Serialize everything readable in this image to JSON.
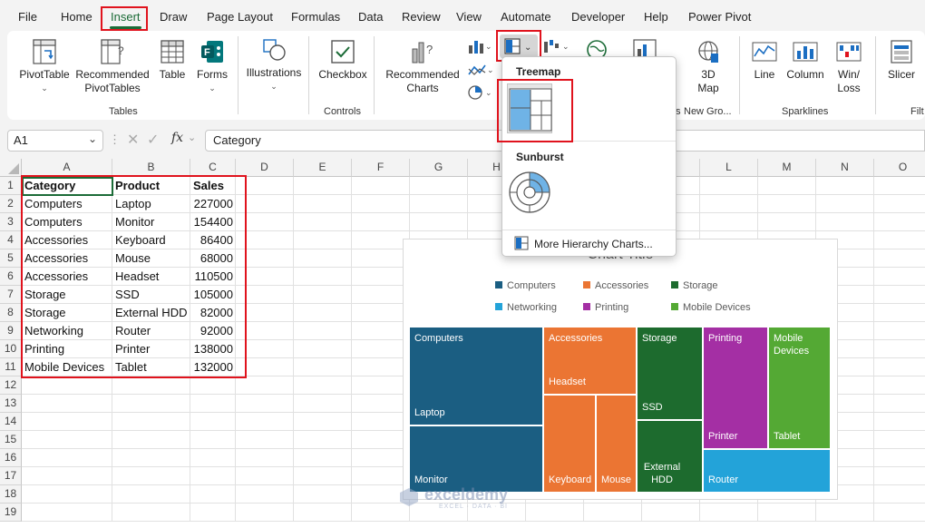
{
  "menu": {
    "tabs": [
      "File",
      "Home",
      "Insert",
      "Draw",
      "Page Layout",
      "Formulas",
      "Data",
      "Review",
      "View",
      "Automate",
      "Developer",
      "Help",
      "Power Pivot"
    ],
    "active": "Insert"
  },
  "ribbon": {
    "pivottable": "PivotTable",
    "recommended_pivottables": "Recommended PivotTables",
    "table": "Table",
    "forms": "Forms",
    "illustrations": "Illustrations",
    "checkbox": "Checkbox",
    "recommended_charts": "Recommended Charts",
    "map": "3D Map",
    "line": "Line",
    "column": "Column",
    "winloss": "Win/ Loss",
    "slicer": "Slicer",
    "groups": {
      "tables": "Tables",
      "controls": "Controls",
      "new_group": "New Gro...",
      "sparklines": "Sparklines",
      "filters": "Filt"
    }
  },
  "formula_bar": {
    "name_box": "A1",
    "fx": "fx",
    "formula": "Category"
  },
  "columns": [
    "A",
    "B",
    "C",
    "D",
    "E",
    "F",
    "G",
    "H",
    "I",
    "J",
    "K",
    "L",
    "M",
    "N",
    "O"
  ],
  "rows": [
    "1",
    "2",
    "3",
    "4",
    "5",
    "6",
    "7",
    "8",
    "9",
    "10",
    "11",
    "12",
    "13",
    "14",
    "15",
    "16",
    "17",
    "18",
    "19"
  ],
  "table": {
    "headers": [
      "Category",
      "Product",
      "Sales"
    ],
    "rows": [
      [
        "Computers",
        "Laptop",
        "227000"
      ],
      [
        "Computers",
        "Monitor",
        "154400"
      ],
      [
        "Accessories",
        "Keyboard",
        "86400"
      ],
      [
        "Accessories",
        "Mouse",
        "68000"
      ],
      [
        "Accessories",
        "Headset",
        "110500"
      ],
      [
        "Storage",
        "SSD",
        "105000"
      ],
      [
        "Storage",
        "External HDD",
        "82000"
      ],
      [
        "Networking",
        "Router",
        "92000"
      ],
      [
        "Printing",
        "Printer",
        "138000"
      ],
      [
        "Mobile Devices",
        "Tablet",
        "132000"
      ]
    ]
  },
  "dropdown": {
    "treemap_title": "Treemap",
    "sunburst_title": "Sunburst",
    "more_link": "More Hierarchy Charts..."
  },
  "chart": {
    "title": "Chart Title",
    "legend": [
      {
        "name": "Computers",
        "color": "#1b5e82"
      },
      {
        "name": "Accessories",
        "color": "#eb7533"
      },
      {
        "name": "Storage",
        "color": "#1d6b2e"
      },
      {
        "name": "Networking",
        "color": "#23a3d9"
      },
      {
        "name": "Printing",
        "color": "#a42fa4"
      },
      {
        "name": "Mobile Devices",
        "color": "#54a934"
      }
    ],
    "tiles": {
      "computers": {
        "parent": "Computers",
        "leaf": "Laptop"
      },
      "monitor": {
        "leaf": "Monitor"
      },
      "accessories": {
        "parent": "Accessories",
        "leaf": "Headset"
      },
      "keyboard": {
        "leaf": "Keyboard"
      },
      "mouse": {
        "leaf": "Mouse"
      },
      "storage": {
        "parent": "Storage",
        "leaf": "SSD"
      },
      "hdd": {
        "leaf": "External HDD"
      },
      "printing": {
        "parent": "Printing",
        "leaf": "Printer"
      },
      "mobile": {
        "parent": "Mobile Devices",
        "leaf": "Tablet"
      },
      "router": {
        "leaf": "Router"
      }
    }
  },
  "chart_data": {
    "type": "treemap",
    "title": "Chart Title",
    "categories": [
      "Computers",
      "Computers",
      "Accessories",
      "Accessories",
      "Accessories",
      "Storage",
      "Storage",
      "Networking",
      "Printing",
      "Mobile Devices"
    ],
    "labels": [
      "Laptop",
      "Monitor",
      "Keyboard",
      "Mouse",
      "Headset",
      "SSD",
      "External HDD",
      "Router",
      "Printer",
      "Tablet"
    ],
    "values": [
      227000,
      154400,
      86400,
      68000,
      110500,
      105000,
      82000,
      92000,
      138000,
      132000
    ]
  },
  "watermark": {
    "brand": "exceldemy",
    "tagline": "EXCEL · DATA · BI"
  }
}
